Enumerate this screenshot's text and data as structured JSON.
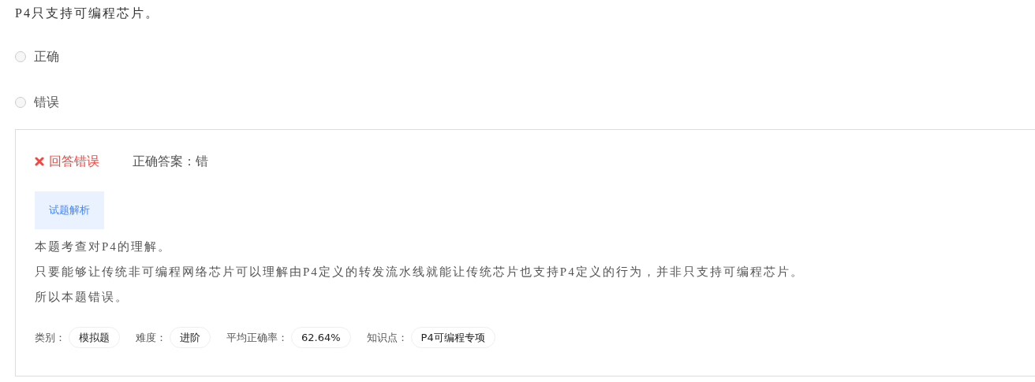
{
  "question": "P4只支持可编程芯片。",
  "options": [
    {
      "label": "正确",
      "selected": false
    },
    {
      "label": "错误",
      "selected": false
    }
  ],
  "result": {
    "kind": "wrong",
    "label": "回答错误",
    "correct_answer": "正确答案：错"
  },
  "analysis_tab": "试题解析",
  "analysis": [
    "本题考查对P4的理解。",
    "只要能够让传统非可编程网络芯片可以理解由P4定义的转发流水线就能让传统芯片也支持P4定义的行为，并非只支持可编程芯片。",
    "所以本题错误。"
  ],
  "meta": [
    {
      "label": "类别：",
      "value": "模拟题"
    },
    {
      "label": "难度：",
      "value": "进阶"
    },
    {
      "label": "平均正确率：",
      "value": "62.64%"
    },
    {
      "label": "知识点：",
      "value": "P4可编程专项"
    }
  ]
}
